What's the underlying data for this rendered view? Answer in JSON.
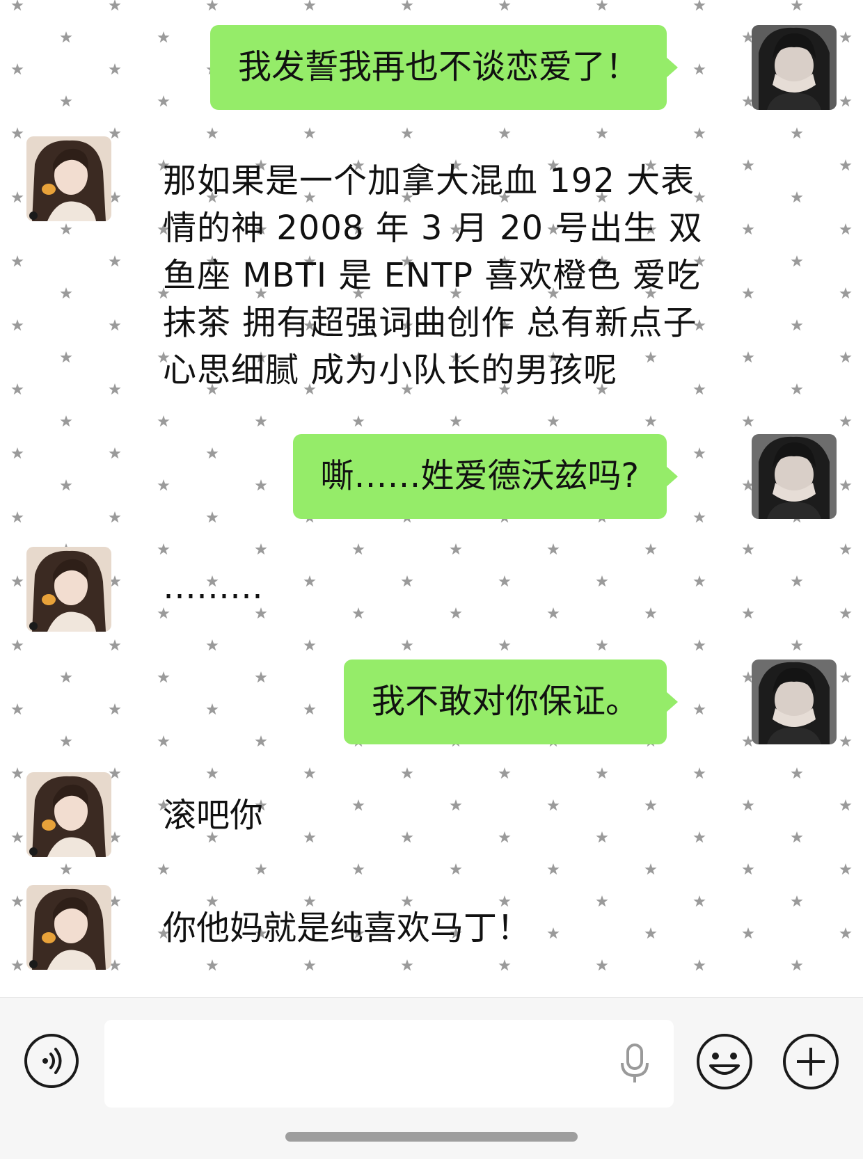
{
  "colors": {
    "outgoing_bubble": "#95ec69",
    "chat_background": "#ffffff",
    "star": "#9a9a9a",
    "input_bar": "#f6f6f6"
  },
  "messages": [
    {
      "from": "me",
      "text": "我发誓我再也不谈恋爱了！"
    },
    {
      "from": "them",
      "text": "那如果是一个加拿大混血 192 大表情的神 2008 年 3 月 20 号出生 双鱼座 MBTI 是 ENTP 喜欢橙色 爱吃抹茶 拥有超强词曲创作 总有新点子 心思细腻 成为小队长的男孩呢"
    },
    {
      "from": "me",
      "text": "嘶……姓爱德沃兹吗?"
    },
    {
      "from": "them",
      "text": "………"
    },
    {
      "from": "me",
      "text": "我不敢对你保证。"
    },
    {
      "from": "them",
      "text": "滚吧你"
    },
    {
      "from": "them",
      "text": "你他妈就是纯喜欢马丁！"
    }
  ],
  "input_bar": {
    "voice_icon": "voice-mode-icon",
    "mic_icon": "microphone-icon",
    "emoji_icon": "emoji-icon",
    "plus_icon": "plus-icon",
    "placeholder": ""
  }
}
